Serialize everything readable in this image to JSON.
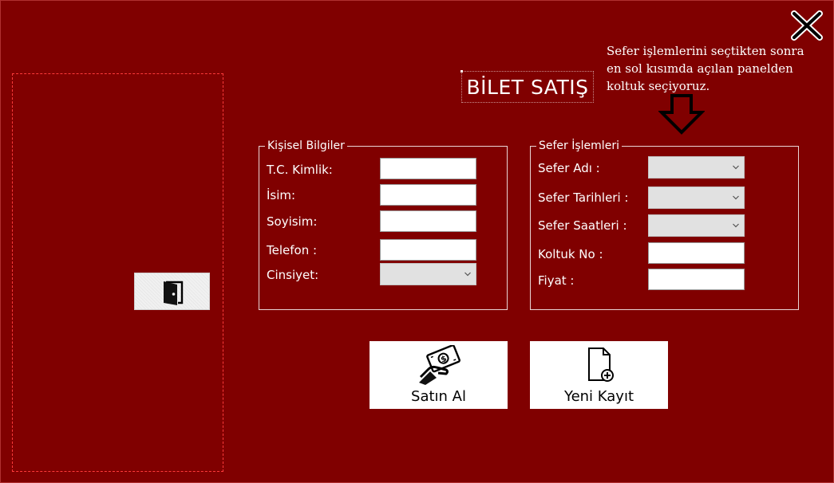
{
  "window": {
    "title": "BİLET SATIŞ",
    "note": "Sefer işlemlerini seçtikten sonra\nen sol kısımda açılan panelden\nkoltuk seçiyoruz."
  },
  "icons": {
    "close": "close-icon",
    "arrow": "arrow-down-icon",
    "exit": "door-exit-icon",
    "buy": "money-hand-icon",
    "new": "file-add-icon"
  },
  "personal": {
    "legend": "Kişisel Bilgiler",
    "fields": [
      {
        "label": "T.C. Kimlik:",
        "value": ""
      },
      {
        "label": "İsim:",
        "value": ""
      },
      {
        "label": "Soyisim:",
        "value": ""
      },
      {
        "label": "Telefon :",
        "value": ""
      },
      {
        "label": "Cinsiyet:",
        "value": ""
      }
    ]
  },
  "sefer": {
    "legend": "Sefer İşlemleri",
    "fields": [
      {
        "label": "Sefer Adı :",
        "value": ""
      },
      {
        "label": "Sefer Tarihleri :",
        "value": ""
      },
      {
        "label": "Sefer Saatleri :",
        "value": ""
      },
      {
        "label": "Koltuk No :",
        "value": ""
      },
      {
        "label": "Fiyat :",
        "value": ""
      }
    ]
  },
  "buttons": {
    "buy": "Satın Al",
    "new": "Yeni Kayıt"
  },
  "colors": {
    "background": "#800000",
    "panel_border": "#ff3a3a",
    "text": "#ffffff"
  }
}
